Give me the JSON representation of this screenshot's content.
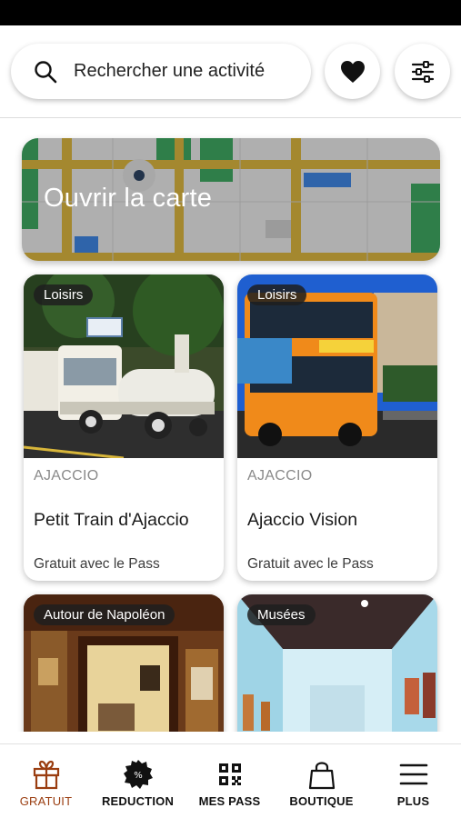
{
  "search": {
    "placeholder": "Rechercher une activité"
  },
  "map_card": {
    "label": "Ouvrir la carte"
  },
  "cards": [
    {
      "tag": "Loisirs",
      "city": "AJACCIO",
      "name": "Petit Train d'Ajaccio",
      "price": "Gratuit avec le Pass"
    },
    {
      "tag": "Loisirs",
      "city": "AJACCIO",
      "name": "Ajaccio Vision",
      "price": "Gratuit avec le Pass"
    },
    {
      "tag": "Autour de Napoléon"
    },
    {
      "tag": "Musées"
    }
  ],
  "tabs": [
    {
      "label": "GRATUIT",
      "icon": "gift-icon",
      "active": true
    },
    {
      "label": "REDUCTION",
      "icon": "discount-badge-icon"
    },
    {
      "label": "MES PASS",
      "icon": "qr-code-icon"
    },
    {
      "label": "BOUTIQUE",
      "icon": "shopping-bag-icon"
    },
    {
      "label": "PLUS",
      "icon": "menu-icon"
    }
  ],
  "colors": {
    "active_tab": "#9a3d10",
    "map_road": "#c9a63a"
  }
}
